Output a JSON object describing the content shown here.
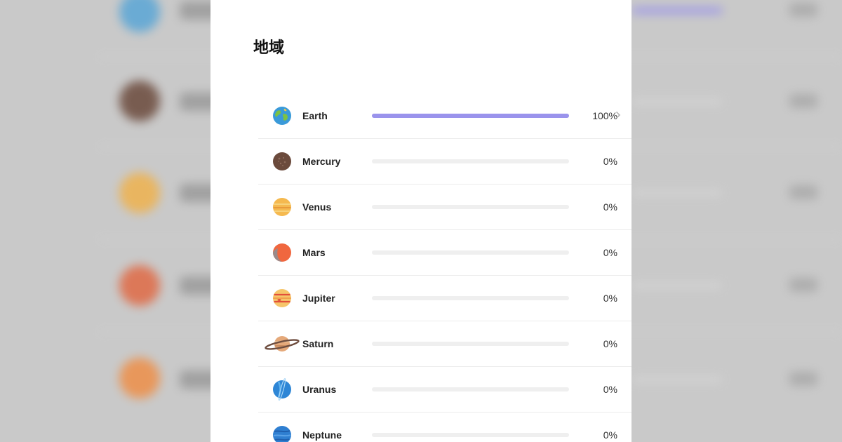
{
  "panel": {
    "title": "地域"
  },
  "planets": [
    {
      "name": "Earth",
      "percent": 100,
      "percent_label": "100%",
      "icon": "earth-icon"
    },
    {
      "name": "Mercury",
      "percent": 0,
      "percent_label": "0%",
      "icon": "mercury-icon"
    },
    {
      "name": "Venus",
      "percent": 0,
      "percent_label": "0%",
      "icon": "venus-icon"
    },
    {
      "name": "Mars",
      "percent": 0,
      "percent_label": "0%",
      "icon": "mars-icon"
    },
    {
      "name": "Jupiter",
      "percent": 0,
      "percent_label": "0%",
      "icon": "jupiter-icon"
    },
    {
      "name": "Saturn",
      "percent": 0,
      "percent_label": "0%",
      "icon": "saturn-icon"
    },
    {
      "name": "Uranus",
      "percent": 0,
      "percent_label": "0%",
      "icon": "uranus-icon"
    },
    {
      "name": "Neptune",
      "percent": 0,
      "percent_label": "0%",
      "icon": "neptune-icon"
    }
  ],
  "colors": {
    "accent": "#9a93ec",
    "track": "#efefef",
    "backdrop": "#c9c9c9"
  }
}
